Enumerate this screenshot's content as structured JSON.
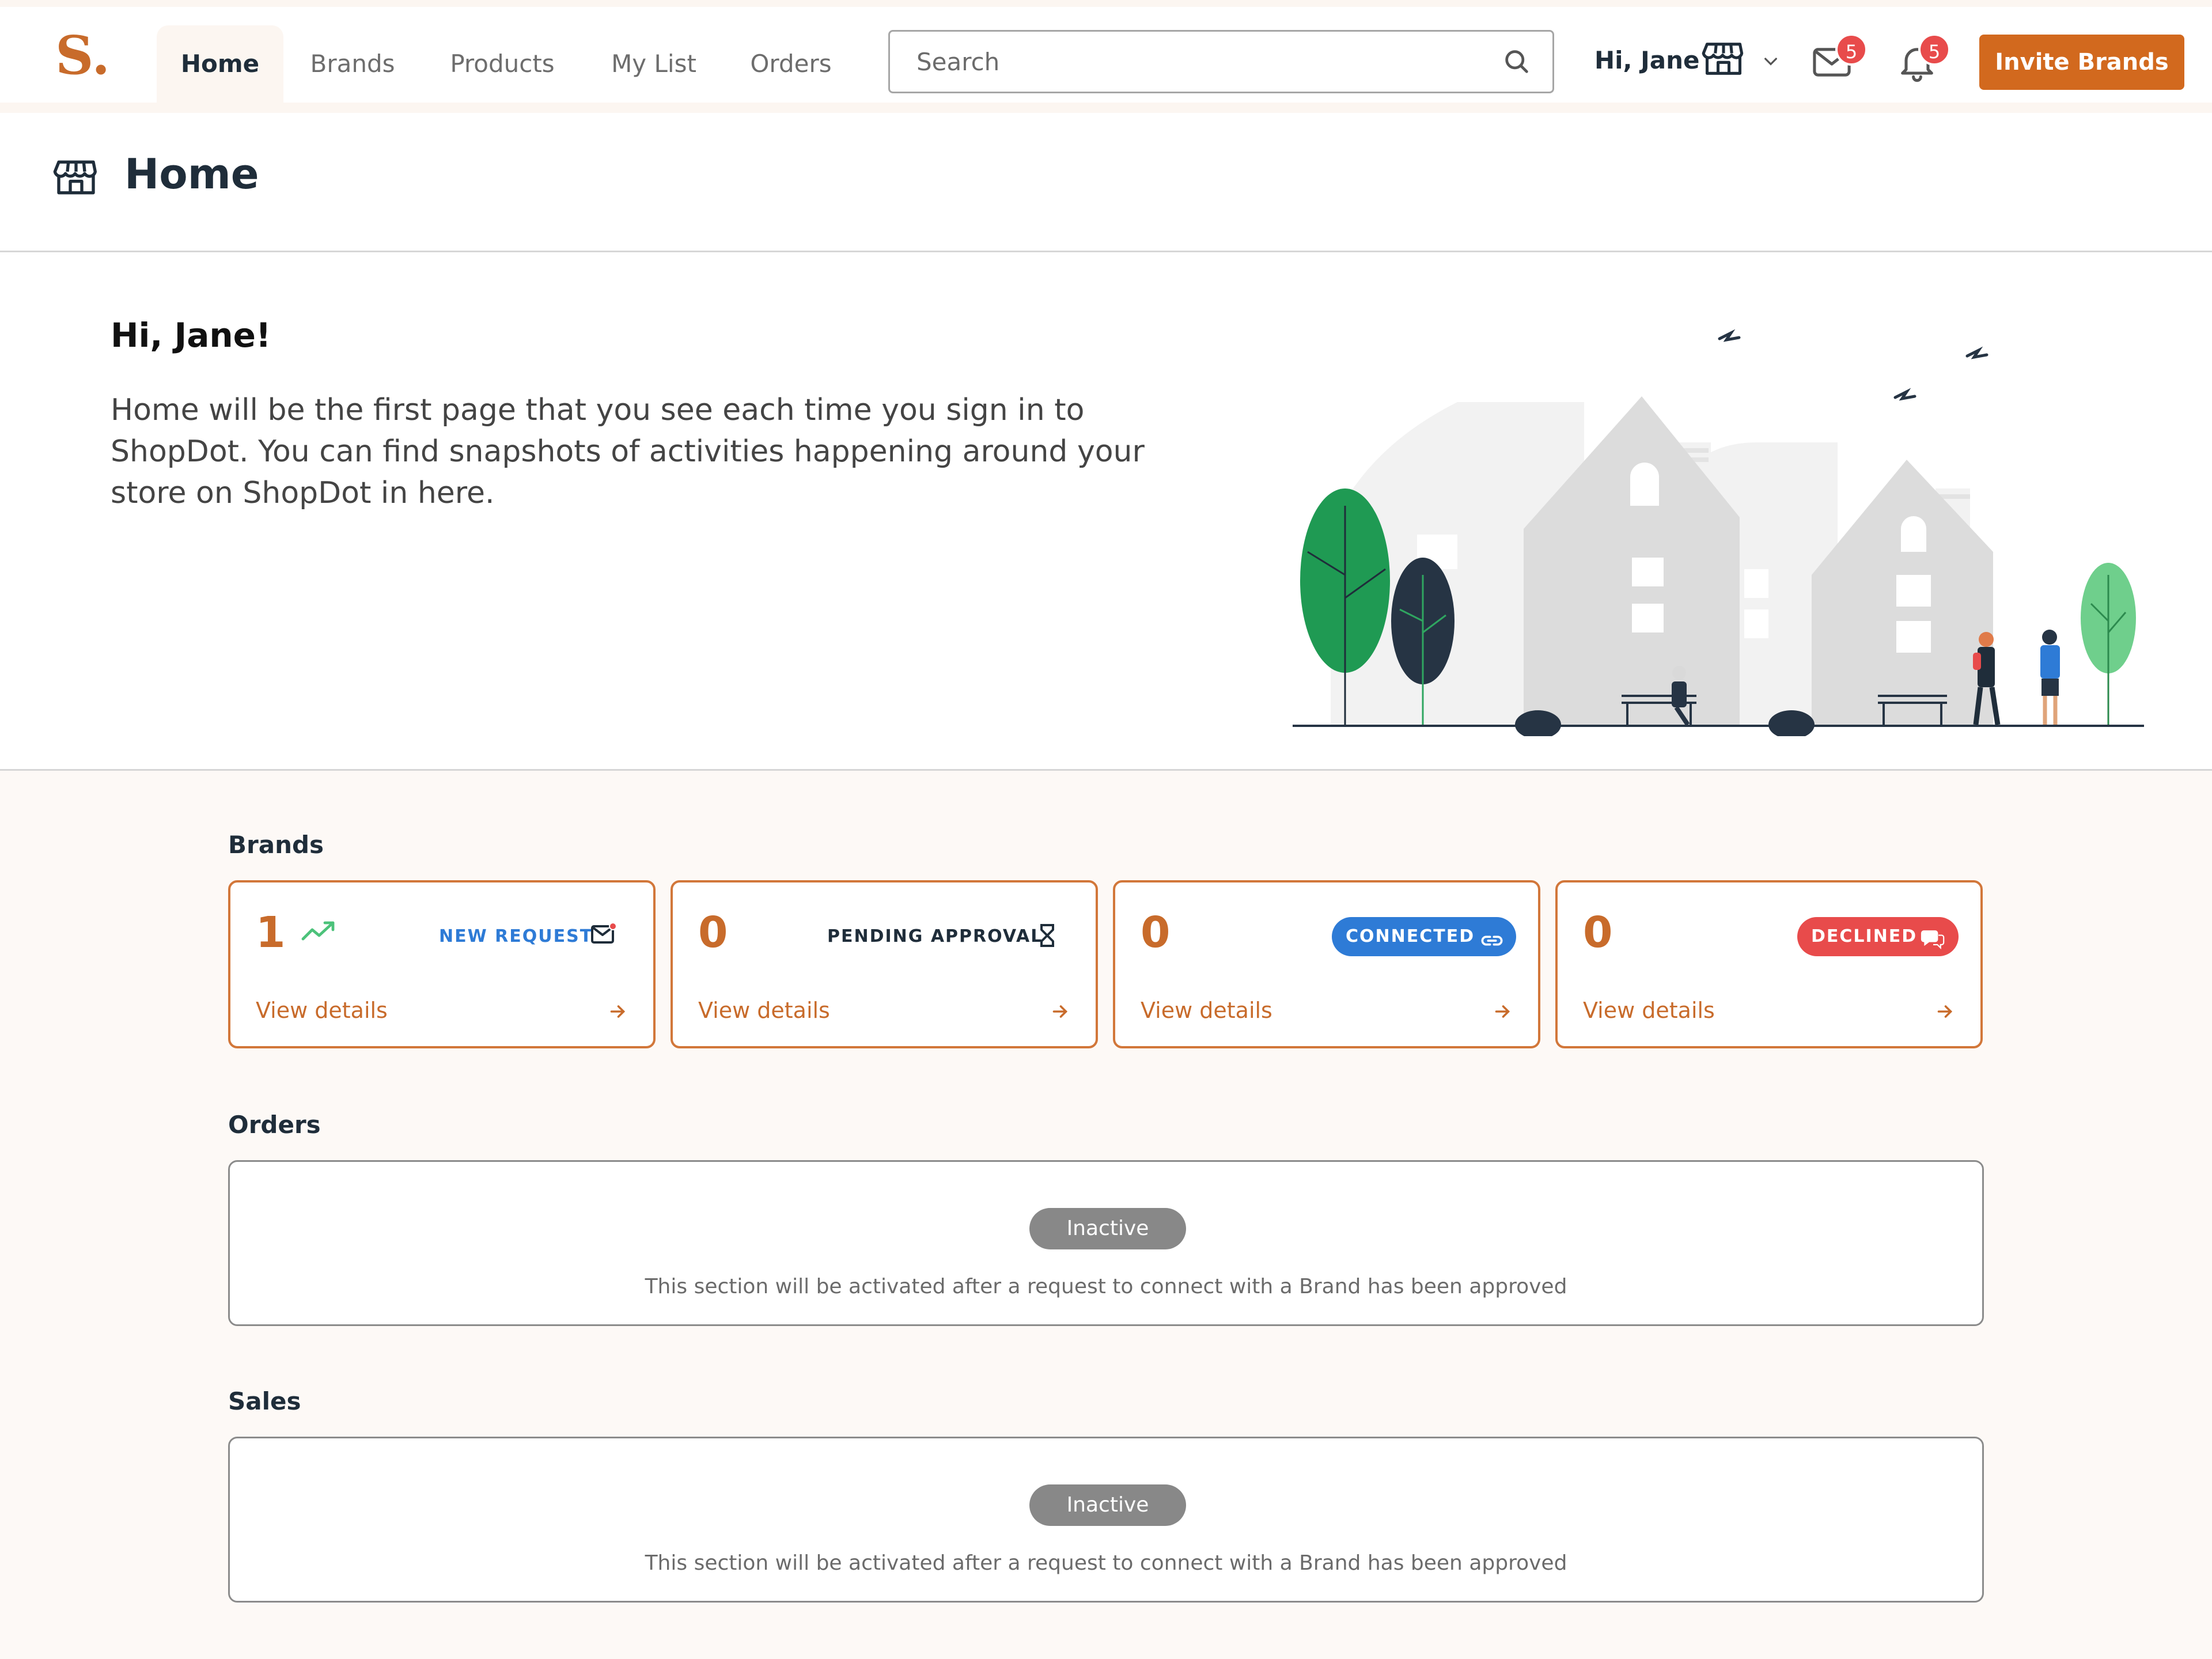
{
  "brand": {
    "logo": "S.",
    "accent": "#d2691e"
  },
  "nav": {
    "tabs": [
      "Home",
      "Brands",
      "Products",
      "My List",
      "Orders"
    ],
    "active": "Home"
  },
  "search": {
    "placeholder": "Search",
    "icon": "search-icon"
  },
  "user": {
    "greeting": "Hi, Jane",
    "store_icon": "storefront-icon",
    "menu_icon": "chevron-down-icon"
  },
  "notifications": {
    "mail_count": "5",
    "bell_count": "5"
  },
  "invite_button": "Invite Brands",
  "page": {
    "title": "Home",
    "icon": "storefront-icon"
  },
  "welcome": {
    "heading": "Hi, Jane!",
    "body": "Home will be the first page that you see each time you sign in to ShopDot. You can find snapshots of activities happening around your store on ShopDot in here."
  },
  "brands": {
    "title": "Brands",
    "cards": [
      {
        "count": "1",
        "status": "NEW REQUEST",
        "status_color": "#2e7bd6",
        "icon": "mail-icon",
        "link": "View details"
      },
      {
        "count": "0",
        "status": "PENDING APPROVAL",
        "status_color": "#1f2d3a",
        "icon": "hourglass-icon",
        "link": "View details"
      },
      {
        "count": "0",
        "status": "CONNECTED",
        "status_color": "#2e7bd6",
        "icon": "link-icon",
        "link": "View details"
      },
      {
        "count": "0",
        "status": "DECLINED",
        "status_color": "#e84b4b",
        "icon": "chat-icon",
        "link": "View details"
      }
    ]
  },
  "orders": {
    "title": "Orders",
    "pill": "Inactive",
    "message": "This section will be activated after a request to connect with a Brand has been approved"
  },
  "sales": {
    "title": "Sales",
    "pill": "Inactive",
    "message": "This section will be activated after a request to connect with a Brand has been approved"
  }
}
